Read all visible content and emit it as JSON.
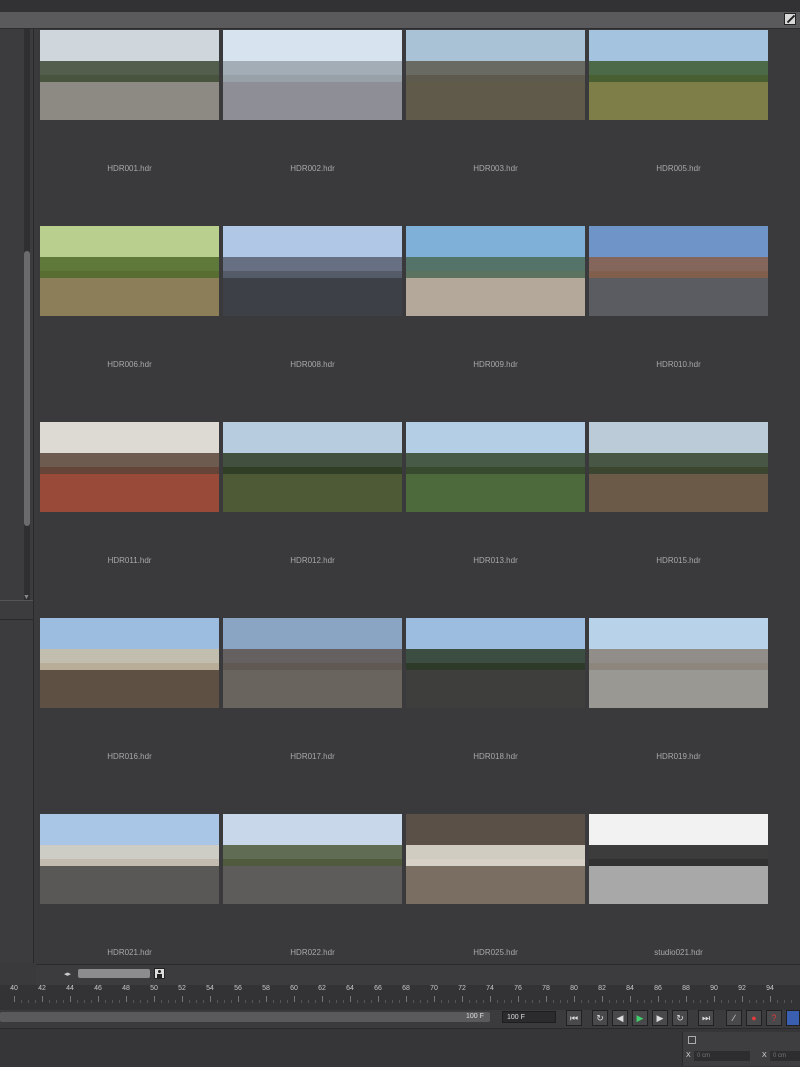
{
  "browser": {
    "items": [
      {
        "label": "HDR001.hdr",
        "sky": "#cfd6dc",
        "trees": "#3d4a33",
        "ground": "#8d8a84"
      },
      {
        "label": "HDR002.hdr",
        "sky": "#d7e3ee",
        "trees": "#9aa3ab",
        "ground": "#8d8e96"
      },
      {
        "label": "HDR003.hdr",
        "sky": "#a9c2d6",
        "trees": "#5e5a4e",
        "ground": "#5f5a4a"
      },
      {
        "label": "HDR005.hdr",
        "sky": "#a4c3de",
        "trees": "#3e5a2e",
        "ground": "#7e7e48"
      },
      {
        "label": "HDR006.hdr",
        "sky": "#b8cf8e",
        "trees": "#4e6a2c",
        "ground": "#8d7e5a"
      },
      {
        "label": "HDR008.hdr",
        "sky": "#b0c8e6",
        "trees": "#5a6070",
        "ground": "#3e4048"
      },
      {
        "label": "HDR009.hdr",
        "sky": "#7fb0d8",
        "trees": "#4c6a56",
        "ground": "#b4a89a"
      },
      {
        "label": "HDR010.hdr",
        "sky": "#6f94c8",
        "trees": "#8a5e4a",
        "ground": "#5a5c62"
      },
      {
        "label": "HDR011.hdr",
        "sky": "#dcdad2",
        "trees": "#5a4438",
        "ground": "#9a4a38"
      },
      {
        "label": "HDR012.hdr",
        "sky": "#b8cce0",
        "trees": "#2c3a22",
        "ground": "#4e5a36"
      },
      {
        "label": "HDR013.hdr",
        "sky": "#b4cee6",
        "trees": "#34442a",
        "ground": "#4c6a3c"
      },
      {
        "label": "HDR015.hdr",
        "sky": "#bccbd8",
        "trees": "#33422c",
        "ground": "#6c5a48"
      },
      {
        "label": "HDR016.hdr",
        "sky": "#9cbce0",
        "trees": "#c8bea6",
        "ground": "#5e5042"
      },
      {
        "label": "HDR017.hdr",
        "sky": "#8aa4c4",
        "trees": "#5e5650",
        "ground": "#6a645e"
      },
      {
        "label": "HDR018.hdr",
        "sky": "#9cbce0",
        "trees": "#2c3a26",
        "ground": "#3e3e3c"
      },
      {
        "label": "HDR019.hdr",
        "sky": "#b8d2ea",
        "trees": "#8a8278",
        "ground": "#9a9892"
      },
      {
        "label": "HDR021.hdr",
        "sky": "#aac6e6",
        "trees": "#d4cebe",
        "ground": "#5a5856"
      },
      {
        "label": "HDR022.hdr",
        "sky": "#c8d8ea",
        "trees": "#4e5a3a",
        "ground": "#5e5c5a"
      },
      {
        "label": "HDR025.hdr",
        "sky": "#5a5048",
        "trees": "#e6e2d8",
        "ground": "#7a6e62"
      },
      {
        "label": "studio021.hdr",
        "sky": "#f2f2f2",
        "trees": "#1c1c1c",
        "ground": "#a8a8a8"
      }
    ]
  },
  "timeline": {
    "ruler_labels": [
      "40",
      "42",
      "44",
      "46",
      "48",
      "50",
      "52",
      "54",
      "56",
      "58",
      "60",
      "62",
      "64",
      "66",
      "68",
      "70",
      "72",
      "74",
      "76",
      "78",
      "80",
      "82",
      "84",
      "86",
      "88",
      "90",
      "92",
      "94"
    ],
    "end_frame_slider": "100 F",
    "end_frame_field": "100 F"
  },
  "transport": {
    "go_start": "⏮",
    "loop": "↻",
    "prev": "◀",
    "play": "▶",
    "next": "▶",
    "record": "↻",
    "go_end": "⏭",
    "key": "∕",
    "record_active": "●",
    "help": "?"
  },
  "coords": {
    "x_label": "X",
    "x_value": "0 cm",
    "x2_label": "X",
    "x2_value": "0 cm"
  }
}
